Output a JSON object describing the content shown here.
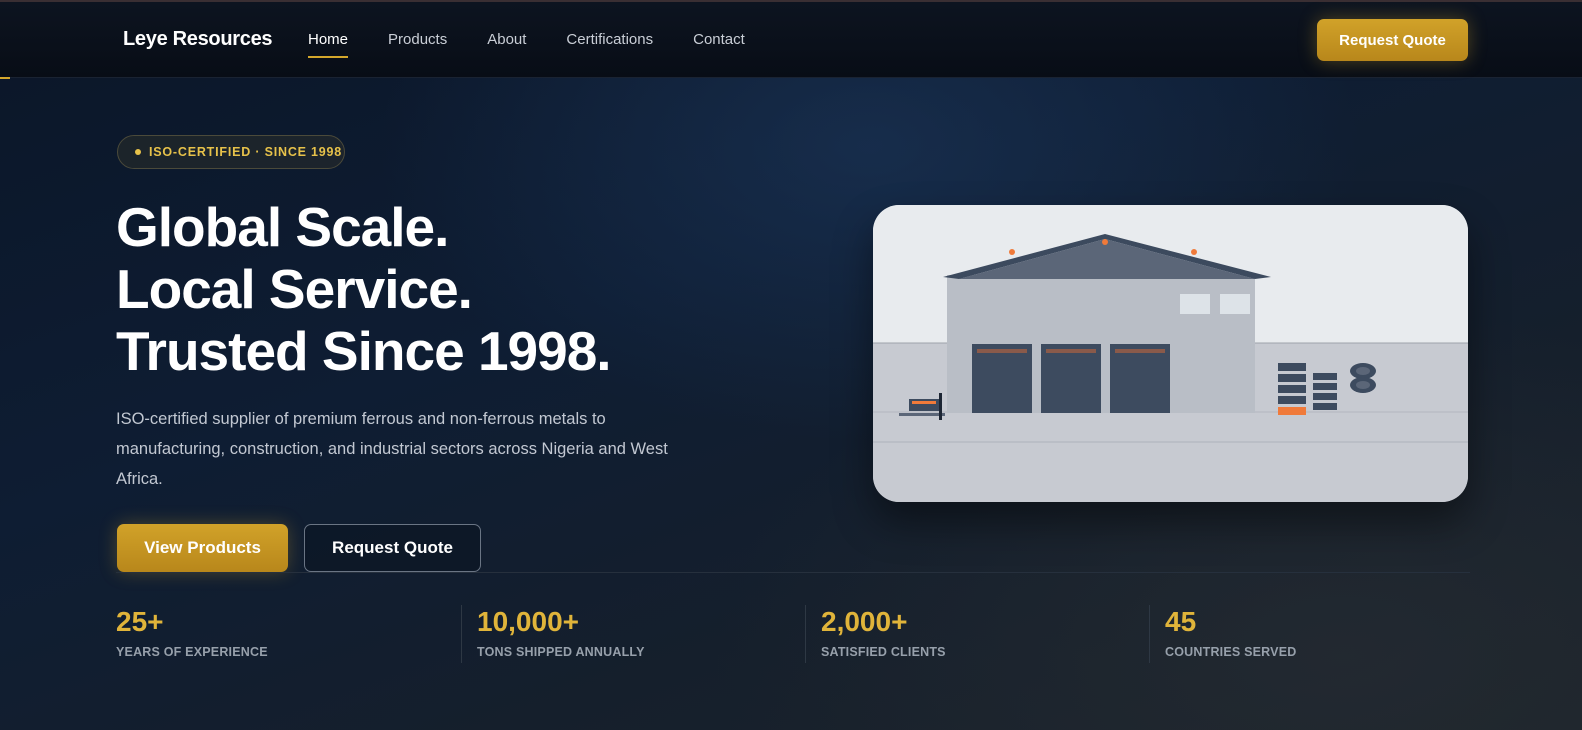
{
  "header": {
    "logo": "Leye Resources",
    "nav": [
      {
        "label": "Home",
        "active": true
      },
      {
        "label": "Products",
        "active": false
      },
      {
        "label": "About",
        "active": false
      },
      {
        "label": "Certifications",
        "active": false
      },
      {
        "label": "Contact",
        "active": false
      }
    ],
    "cta_label": "Request Quote"
  },
  "hero": {
    "badge": "ISO-CERTIFIED · SINCE 1998",
    "title_lines": [
      "Global Scale.",
      "Local Service.",
      "Trusted Since 1998."
    ],
    "description": "ISO-certified supplier of premium ferrous and non-ferrous metals to manufacturing, construction, and industrial sectors across Nigeria and West Africa.",
    "primary_button": "View Products",
    "secondary_button": "Request Quote",
    "illustration": "warehouse-illustration"
  },
  "stats": [
    {
      "value": "25+",
      "label": "YEARS OF EXPERIENCE"
    },
    {
      "value": "10,000+",
      "label": "TONS SHIPPED ANNUALLY"
    },
    {
      "value": "2,000+",
      "label": "SATISFIED CLIENTS"
    },
    {
      "value": "45",
      "label": "COUNTRIES SERVED"
    }
  ],
  "colors": {
    "accent": "#d4a72c",
    "background": "#0e1d33",
    "stat_value": "#e0b43a"
  }
}
